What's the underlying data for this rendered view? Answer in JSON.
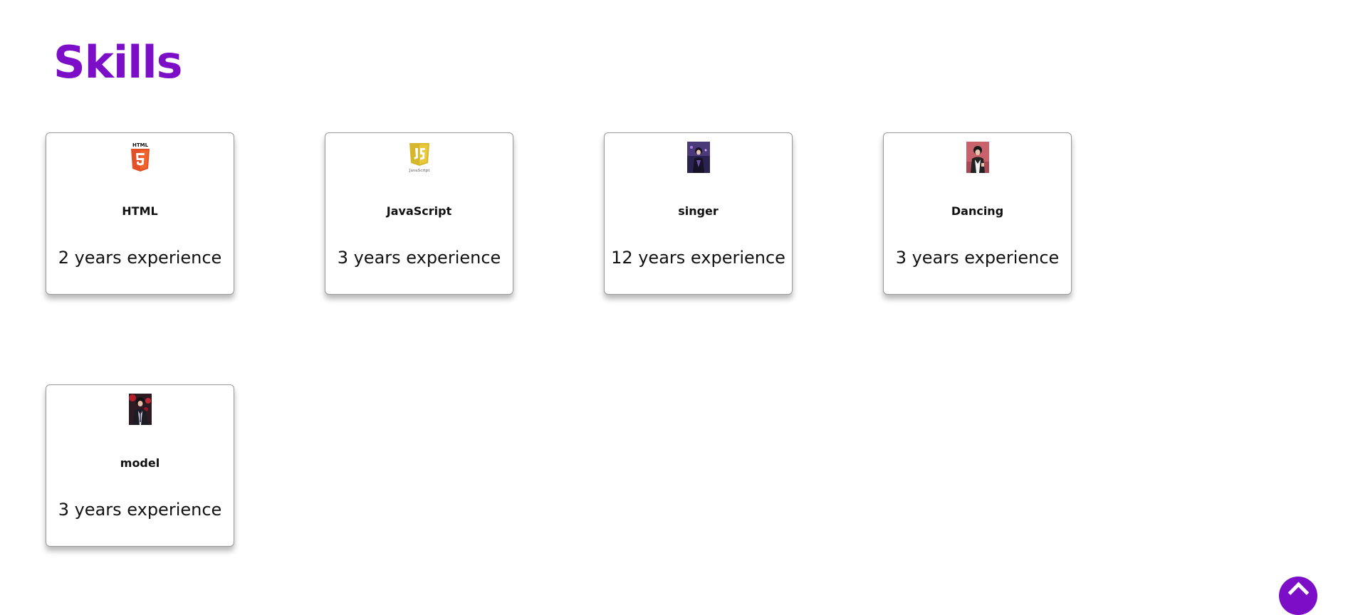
{
  "page": {
    "title": "Skills",
    "accent_color": "#7b0ec6"
  },
  "skills": [
    {
      "icon": "html5-logo-icon",
      "name": "HTML",
      "experience": "2 years experience"
    },
    {
      "icon": "javascript-logo-icon",
      "name": "JavaScript",
      "experience": "3 years experience"
    },
    {
      "icon": "singer-photo-icon",
      "name": "singer",
      "experience": "12 years experience"
    },
    {
      "icon": "dancer-photo-icon",
      "name": "Dancing",
      "experience": "3 years experience"
    },
    {
      "icon": "model-photo-icon",
      "name": "model",
      "experience": "3 years experience"
    }
  ],
  "scroll_top": {
    "icon": "chevron-up-icon"
  }
}
